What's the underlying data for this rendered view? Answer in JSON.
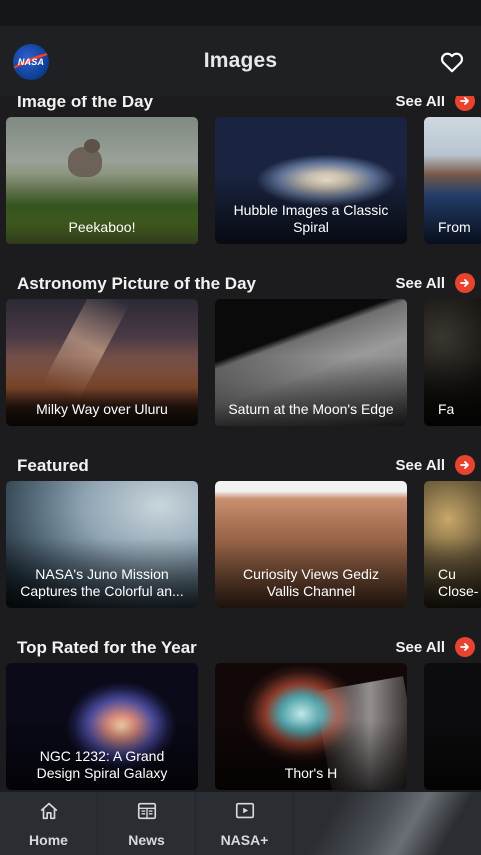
{
  "app": {
    "title": "Images",
    "logo_text": "NASA"
  },
  "icons": {
    "logo": "nasa-meatball-logo",
    "favorite": "heart-icon",
    "arrow": "arrow-right-icon"
  },
  "colors": {
    "accent": "#e8432f",
    "background": "#1c1c1f",
    "appbar": "#1e2024",
    "navbar": "#2a2d32"
  },
  "sections": [
    {
      "title": "Image of the Day",
      "see_all": "See All",
      "cards": [
        {
          "lines": [
            "Peekaboo!"
          ]
        },
        {
          "lines": [
            "Hubble Images a Classic",
            "Spiral"
          ]
        },
        {
          "lines": [
            "From"
          ]
        }
      ]
    },
    {
      "title": "Astronomy Picture of the Day",
      "see_all": "See All",
      "cards": [
        {
          "lines": [
            "Milky Way over Uluru"
          ]
        },
        {
          "lines": [
            "Saturn at the Moon's Edge"
          ]
        },
        {
          "lines": [
            "Fa"
          ]
        }
      ]
    },
    {
      "title": "Featured",
      "see_all": "See All",
      "cards": [
        {
          "lines": [
            "NASA's Juno Mission",
            "Captures the Colorful an..."
          ]
        },
        {
          "lines": [
            "Curiosity Views Gediz",
            "Vallis Channel"
          ]
        },
        {
          "lines": [
            "Cu",
            "Close-"
          ]
        }
      ]
    },
    {
      "title": "Top Rated for the Year",
      "see_all": "See All",
      "cards": [
        {
          "lines": [
            "NGC 1232: A Grand",
            "Design Spiral Galaxy"
          ]
        },
        {
          "lines": [
            "Thor's H"
          ]
        },
        {
          "lines": [
            ""
          ]
        }
      ]
    }
  ],
  "nav": [
    {
      "label": "Home",
      "icon": "home-icon"
    },
    {
      "label": "News",
      "icon": "news-icon"
    },
    {
      "label": "NASA+",
      "icon": "play-icon"
    }
  ]
}
